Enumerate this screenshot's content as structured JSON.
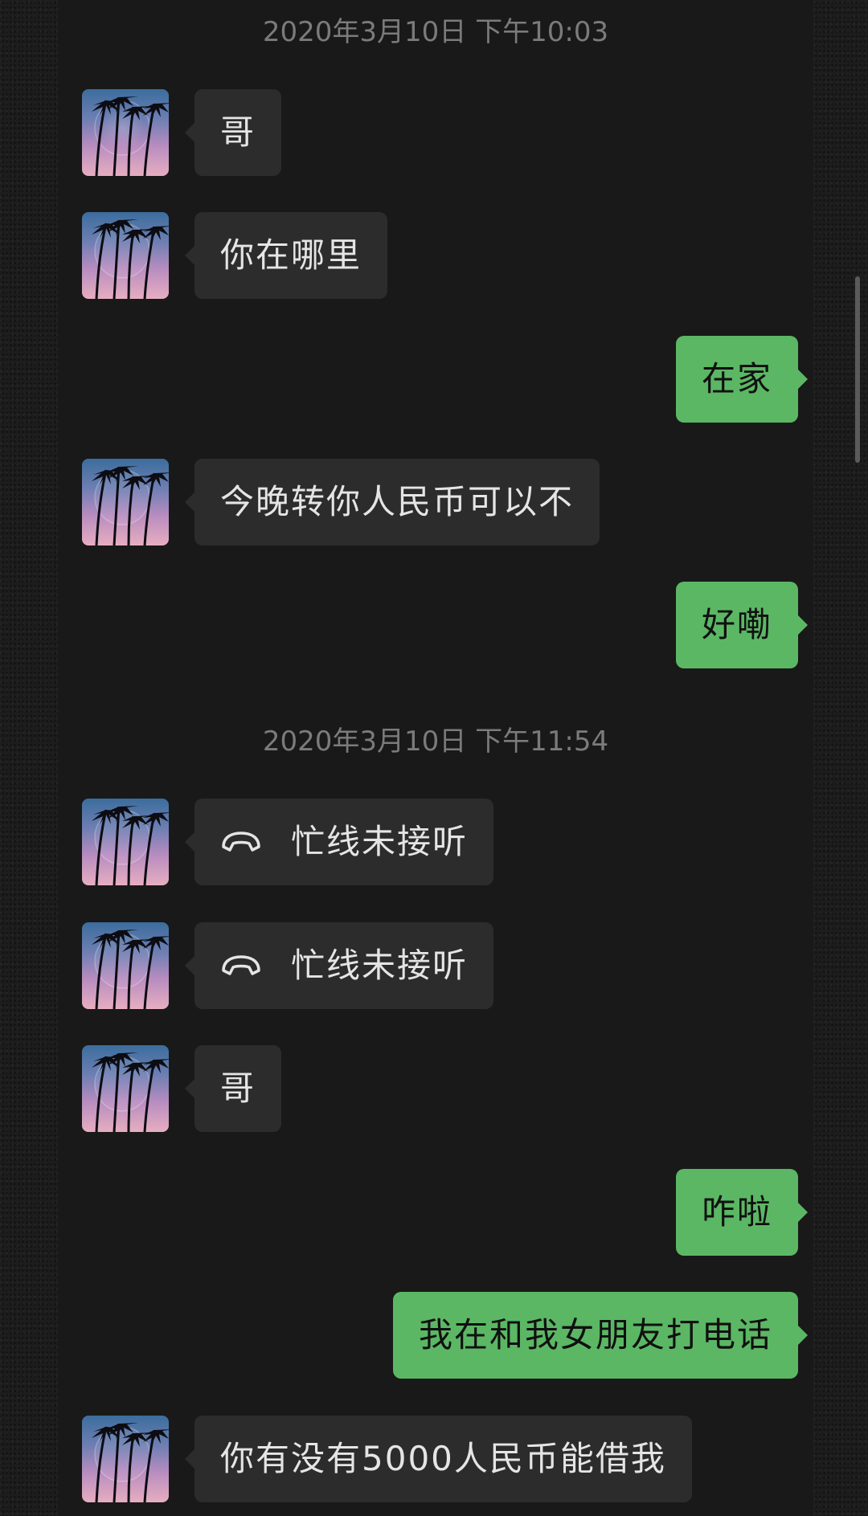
{
  "timestamps": [
    "2020年3月10日 下午10:03",
    "2020年3月10日 下午11:54"
  ],
  "messages": [
    {
      "side": "in",
      "text": "哥"
    },
    {
      "side": "in",
      "text": "你在哪里"
    },
    {
      "side": "out",
      "text": "在家"
    },
    {
      "side": "in",
      "text": "今晚转你人民币可以不"
    },
    {
      "side": "out",
      "text": "好嘞"
    },
    {
      "side": "in",
      "type": "call",
      "icon": "phone-hangup-icon",
      "text": "忙线未接听"
    },
    {
      "side": "in",
      "type": "call",
      "icon": "phone-hangup-icon",
      "text": "忙线未接听"
    },
    {
      "side": "in",
      "text": "哥"
    },
    {
      "side": "out",
      "text": "咋啦"
    },
    {
      "side": "out",
      "text": "我在和我女朋友打电话"
    },
    {
      "side": "in",
      "text": "你有没有5000人民币能借我"
    }
  ],
  "colors": {
    "incoming_bubble": "#2c2c2c",
    "outgoing_bubble": "#5bb764",
    "background": "#191919",
    "timestamp": "#7b7b7b"
  }
}
